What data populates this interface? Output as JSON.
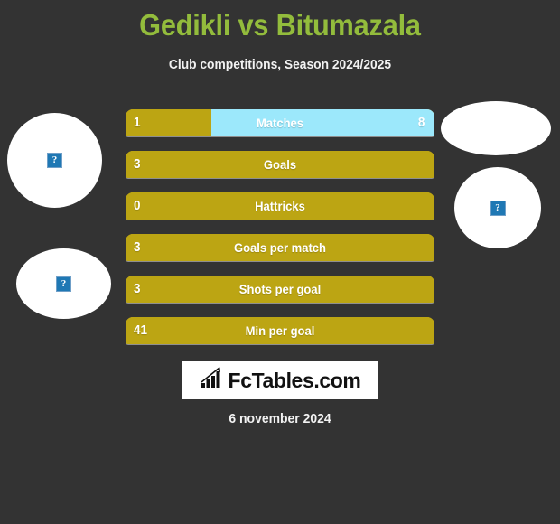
{
  "header": {
    "title": "Gedikli vs Bitumazala",
    "subtitle": "Club competitions, Season 2024/2025",
    "title_color": "#93bc3c"
  },
  "avatars": [
    {
      "name": "player-left-top",
      "alt": "?",
      "side": "left"
    },
    {
      "name": "player-left-bottom",
      "alt": "?",
      "side": "left"
    },
    {
      "name": "player-right-top",
      "alt": "?",
      "side": "right"
    },
    {
      "name": "player-right-bottom",
      "alt": "?",
      "side": "right"
    }
  ],
  "colors": {
    "background": "#333333",
    "bar_gold": "#bca513",
    "bar_blue": "#9ce8fb",
    "accent_green": "#93bc3c",
    "text": "#ffffff"
  },
  "footer": {
    "logo_text": "FcTables.com",
    "logo_icon": "bar-chart-growth-icon",
    "date": "6 november 2024"
  },
  "chart_data": {
    "type": "bar",
    "title": "Gedikli vs Bitumazala",
    "subtitle": "Club competitions, Season 2024/2025",
    "xlabel": "",
    "ylabel": "",
    "grid": false,
    "legend": false,
    "orientation": "horizontal",
    "style": "paired opposing stat bars",
    "series": [
      {
        "name": "Gedikli",
        "color": "#bca513",
        "values": [
          1,
          3,
          0,
          3,
          3,
          41
        ]
      },
      {
        "name": "Bitumazala",
        "color": "#9ce8fb",
        "values": [
          8,
          null,
          null,
          null,
          null,
          null
        ]
      }
    ],
    "categories": [
      "Matches",
      "Goals",
      "Hattricks",
      "Goals per match",
      "Shots per goal",
      "Min per goal"
    ],
    "rows": [
      {
        "label": "Matches",
        "left_value": "1",
        "right_value": "8",
        "left_pct": 27.8,
        "right_filled": true
      },
      {
        "label": "Goals",
        "left_value": "3",
        "right_value": "",
        "left_pct": 100,
        "right_filled": false
      },
      {
        "label": "Hattricks",
        "left_value": "0",
        "right_value": "",
        "left_pct": 100,
        "right_filled": false
      },
      {
        "label": "Goals per match",
        "left_value": "3",
        "right_value": "",
        "left_pct": 100,
        "right_filled": false
      },
      {
        "label": "Shots per goal",
        "left_value": "3",
        "right_value": "",
        "left_pct": 100,
        "right_filled": false
      },
      {
        "label": "Min per goal",
        "left_value": "41",
        "right_value": "",
        "left_pct": 100,
        "right_filled": false
      }
    ]
  }
}
